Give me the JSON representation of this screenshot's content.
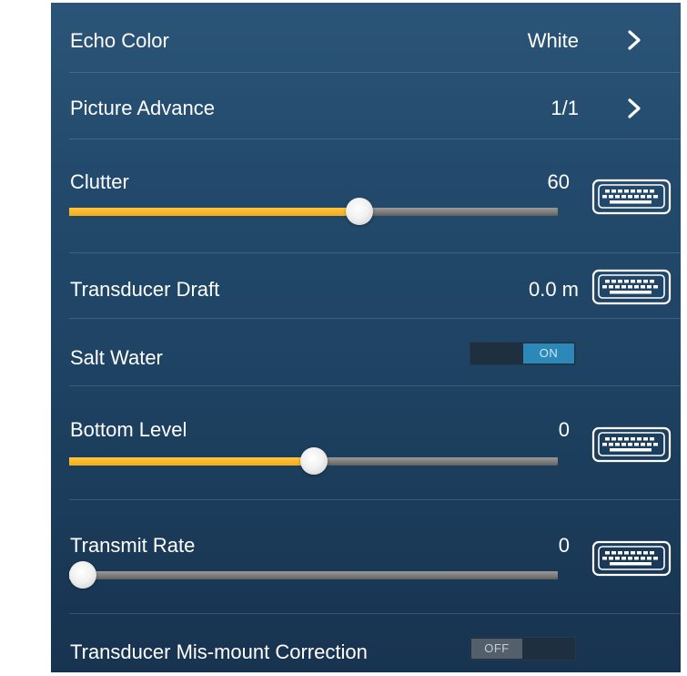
{
  "settings": {
    "echo_color": {
      "label": "Echo Color",
      "value": "White",
      "icon": "chevron-right-icon"
    },
    "picture_advance": {
      "label": "Picture Advance",
      "value": "1/1",
      "icon": "chevron-right-icon"
    },
    "clutter": {
      "label": "Clutter",
      "value": "60",
      "level_percent": 60,
      "icon": "keyboard-icon"
    },
    "transducer_draft": {
      "label": "Transducer Draft",
      "value": "0.0 m",
      "icon": "keyboard-icon"
    },
    "salt_water": {
      "label": "Salt Water",
      "state": "ON"
    },
    "bottom_level": {
      "label": "Bottom Level",
      "value": "0",
      "level_percent": 50,
      "icon": "keyboard-icon"
    },
    "transmit_rate": {
      "label": "Transmit Rate",
      "value": "0",
      "level_percent": 0,
      "icon": "keyboard-icon"
    },
    "transducer_mismount": {
      "label": "Transducer Mis-mount Correction",
      "state": "OFF"
    }
  },
  "colors": {
    "slider_fill": "#f3ad19",
    "toggle_on": "#2b88b8",
    "panel_bg": "#234a6c"
  }
}
